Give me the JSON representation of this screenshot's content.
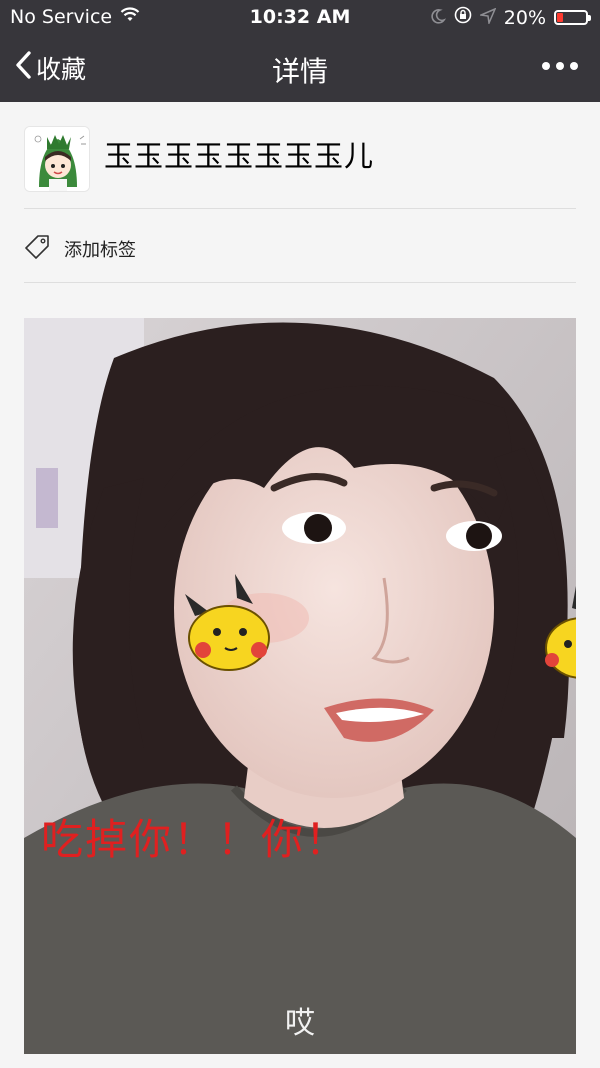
{
  "status_bar": {
    "carrier": "No Service",
    "time": "10:32 AM",
    "battery_percent": "20%",
    "battery_level": 0.2,
    "icons": [
      "wifi-icon",
      "moon-icon",
      "orientation-lock-icon",
      "location-icon",
      "battery-icon"
    ]
  },
  "nav": {
    "back_label": "收藏",
    "title": "详情",
    "more_icon": "more-dots-icon"
  },
  "profile": {
    "username": "玉玉玉玉玉玉玉玉儿"
  },
  "tag": {
    "label": "添加标签",
    "icon": "tag-icon"
  },
  "photo": {
    "caption_red": "吃掉你！！你！",
    "caption_bottom": "哎"
  },
  "colors": {
    "bar_bg": "#37363b",
    "page_bg": "#f5f5f5",
    "caption_red": "#e02020",
    "battery_low": "#ff3b30"
  }
}
